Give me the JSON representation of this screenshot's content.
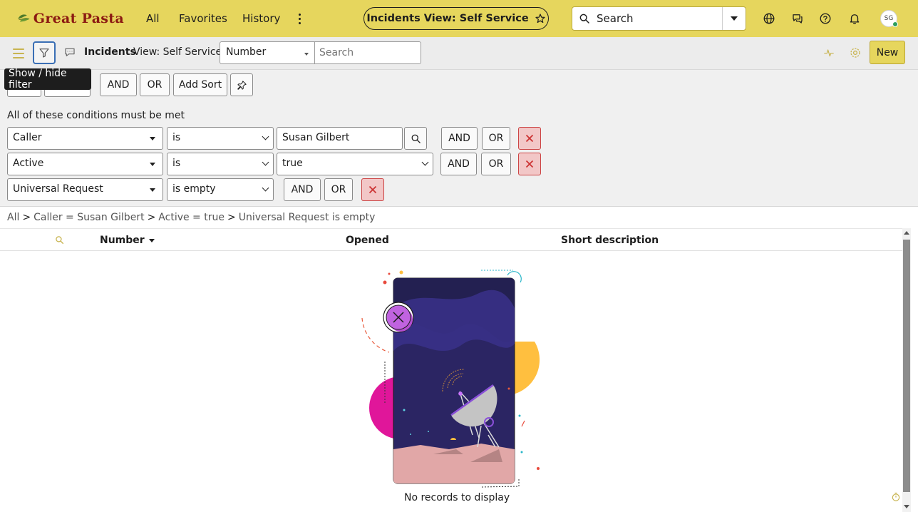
{
  "header": {
    "logo_text": "Great Pasta",
    "nav": {
      "all": "All",
      "favorites": "Favorites",
      "history": "History"
    },
    "context_title": "Incidents View: Self Service",
    "search_placeholder": "Search",
    "avatar_initials": "SG",
    "icons": [
      "more-vertical-icon",
      "star-icon",
      "search-icon",
      "chevron-down-icon",
      "globe-icon",
      "chat-icon",
      "help-icon",
      "bell-icon"
    ]
  },
  "listbar": {
    "title": "Incidents",
    "view": "View: Self Service",
    "field_selected": "Number",
    "search_placeholder": "Search",
    "new_label": "New"
  },
  "filter": {
    "tooltip": "Show / hide filter",
    "and_label": "AND",
    "or_label": "OR",
    "add_sort_label": "Add Sort",
    "condition_note": "All of these conditions must be met",
    "conditions": [
      {
        "field": "Caller",
        "operator": "is",
        "value": "Susan Gilbert",
        "and": "AND",
        "or": "OR"
      },
      {
        "field": "Active",
        "operator": "is",
        "value": "true",
        "and": "AND",
        "or": "OR"
      },
      {
        "field": "Universal Request",
        "operator": "is empty",
        "and": "AND",
        "or": "OR"
      }
    ]
  },
  "breadcrumb": {
    "items": [
      "All",
      "Caller = Susan Gilbert",
      "Active = true",
      "Universal Request is empty"
    ],
    "separator": ">"
  },
  "table": {
    "columns": {
      "number": "Number",
      "opened": "Opened",
      "short_description": "Short description"
    }
  },
  "empty_state": {
    "message": "No records to display"
  },
  "colors": {
    "brand_yellow": "#e6d65d",
    "logo_red": "#8b1a12",
    "filter_active_border": "#3a6fb5",
    "delete_button_bg": "#f2c7c7",
    "delete_button_border": "#cc4444"
  }
}
